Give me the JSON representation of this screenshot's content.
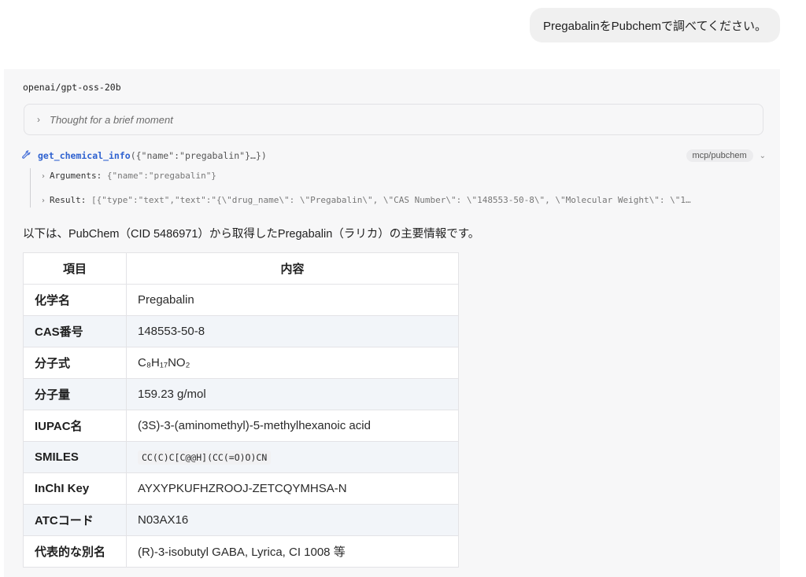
{
  "user_message": "PregabalinをPubchemで調べてください。",
  "assistant": {
    "model": "openai/gpt-oss-20b",
    "thought": {
      "label": "Thought for a brief moment"
    },
    "tool_call": {
      "function": "get_chemical_info",
      "args_preview": "({\"name\":\"pregabalin\"}…})",
      "server_badge": "mcp/pubchem",
      "arguments_label": "Arguments",
      "arguments_value": "{\"name\":\"pregabalin\"}",
      "result_label": "Result",
      "result_value": "[{\"type\":\"text\",\"text\":\"{\\\"drug_name\\\": \\\"Pregabalin\\\", \\\"CAS Number\\\": \\\"148553-50-8\\\", \\\"Molecular Weight\\\": \\\"1…"
    },
    "intro_text": "以下は、PubChem（CID 5486971）から取得したPregabalin（ラリカ）の主要情報です。",
    "table": {
      "headers": [
        "項目",
        "内容"
      ],
      "rows": [
        {
          "key": "化学名",
          "value": "Pregabalin"
        },
        {
          "key": "CAS番号",
          "value": "148553-50-8"
        },
        {
          "key": "分子式",
          "value": "C₈H₁₇NO₂"
        },
        {
          "key": "分子量",
          "value": "159.23 g/mol"
        },
        {
          "key": "IUPAC名",
          "value": "(3S)-3-(aminomethyl)-5-methylhexanoic acid"
        },
        {
          "key": "SMILES",
          "value": "CC(C)C[C@@H](CC(=O)O)CN"
        },
        {
          "key": "InChI Key",
          "value": "AYXYPKUFHZROOJ-ZETCQYMHSA-N"
        },
        {
          "key": "ATCコード",
          "value": "N03AX16"
        },
        {
          "key": "代表的な別名",
          "value": "(R)-3-isobutyl GABA, Lyrica, CI 1008 等"
        }
      ]
    }
  },
  "colors": {
    "accent": "#2f62d0",
    "user_bubble": "#f0f0f0",
    "panel": "#f7f7f8",
    "table_alt_row": "#f2f5f9"
  },
  "icons": {
    "tool": "wrench-icon",
    "expand": "chevron-right-icon",
    "collapse": "chevron-down-icon"
  }
}
